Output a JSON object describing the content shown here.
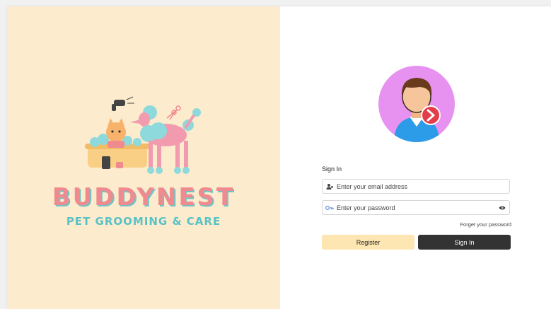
{
  "brand": {
    "name": "BUDDYNEST",
    "tagline": "PET GROOMING & CARE",
    "colors": {
      "panel": "#fdebcd",
      "name": "#ef8a8f",
      "shadow": "#6fc4c7",
      "tagline": "#58c2c6"
    }
  },
  "avatar": {
    "icon": "user-sign-in-avatar-icon",
    "background": "#e792f0",
    "badge_color": "#e43d4a"
  },
  "signin": {
    "title": "Sign In",
    "email": {
      "placeholder": "Enter your email address",
      "value": "",
      "icon": "user-card-icon"
    },
    "password": {
      "placeholder": "Enter your password",
      "value": "",
      "icon": "key-icon",
      "toggle_icon": "eye-icon"
    },
    "forgot_label": "Forget your password",
    "register_label": "Register",
    "signin_label": "Sign In"
  },
  "colors": {
    "register_button": "#fde6b1",
    "signin_button": "#333333"
  }
}
